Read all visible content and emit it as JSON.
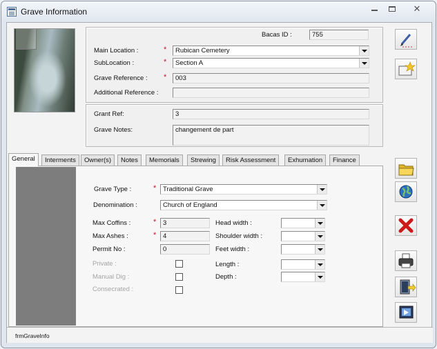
{
  "window": {
    "title": "Grave Information"
  },
  "header": {
    "bacas_id_label": "Bacas ID :",
    "bacas_id_value": "755",
    "main_location_label": "Main Location :",
    "main_location_value": "Rubican Cemetery",
    "sublocation_label": "SubLocation :",
    "sublocation_value": "Section A",
    "grave_reference_label": "Grave Reference :",
    "grave_reference_value": "003",
    "additional_reference_label": "Additional Reference :",
    "additional_reference_value": "",
    "required_marker": "*"
  },
  "notes_section": {
    "grant_ref_label": "Grant Ref:",
    "grant_ref_value": "3",
    "grave_notes_label": "Grave Notes:",
    "grave_notes_value": "changement de part"
  },
  "tabs": [
    {
      "label": "General"
    },
    {
      "label": "Interments"
    },
    {
      "label": "Owner(s)"
    },
    {
      "label": "Notes"
    },
    {
      "label": "Memorials"
    },
    {
      "label": "Strewing"
    },
    {
      "label": "Risk Assessment"
    },
    {
      "label": "Exhumation"
    },
    {
      "label": "Finance"
    }
  ],
  "general": {
    "grave_type_label": "Grave Type :",
    "grave_type_value": "Traditional Grave",
    "denomination_label": "Denomination :",
    "denomination_value": "Church of England",
    "max_coffins_label": "Max Coffins :",
    "max_coffins_value": "3",
    "max_ashes_label": "Max Ashes :",
    "max_ashes_value": "4",
    "permit_no_label": "Permit No :",
    "permit_no_value": "0",
    "private_label": "Private :",
    "manual_dig_label": "Manual Dig :",
    "consecrated_label": "Consecrated :",
    "head_width_label": "Head width :",
    "shoulder_width_label": "Shoulder width :",
    "feet_width_label": "Feet width :",
    "length_label": "Length :",
    "depth_label": "Depth :"
  },
  "toolbar": {
    "icons": [
      "edit-pencil-icon",
      "new-record-star-icon",
      "open-folder-icon",
      "globe-icon",
      "delete-x-icon",
      "print-icon",
      "exit-door-icon",
      "close-form-icon"
    ]
  },
  "status": {
    "form_name": "frmGraveInfo"
  },
  "colors": {
    "required": "#c8102e",
    "delete": "#cc1a1a",
    "graybar": "#7d7d7d"
  }
}
